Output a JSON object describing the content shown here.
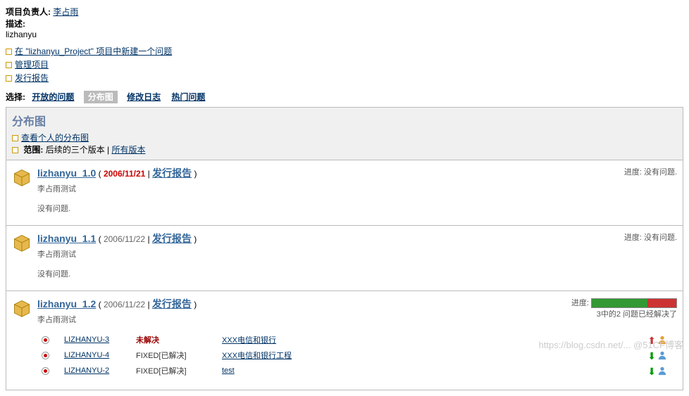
{
  "header": {
    "owner_label": "项目负责人:",
    "owner_name": "李占雨",
    "desc_label": "描述:",
    "desc_value": "lizhanyu"
  },
  "actions": {
    "create_issue": "在 \"lizhanyu_Project\" 项目中新建一个问题",
    "manage_project": "管理项目",
    "release_report": "发行报告"
  },
  "tabs": {
    "select_label": "选择:",
    "open_issues": "开放的问题",
    "chart": "分布图",
    "changelog": "修改日志",
    "hot_issues": "热门问题"
  },
  "panel": {
    "title": "分布图",
    "personal_chart": "查看个人的分布图",
    "scope_label": "范围:",
    "scope_recent": "后续的三个版本 |",
    "scope_all": "所有版本"
  },
  "versions": [
    {
      "name": "lizhanyu_1.0",
      "date": "2006/11/21",
      "overdue": true,
      "report": "发行报告",
      "desc": "李占雨测试",
      "no_issues": "没有问题.",
      "progress_label": "进度:",
      "progress_text": "没有问题."
    },
    {
      "name": "lizhanyu_1.1",
      "date": "2006/11/22",
      "overdue": false,
      "report": "发行报告",
      "desc": "李占雨测试",
      "no_issues": "没有问题.",
      "progress_label": "进度:",
      "progress_text": "没有问题."
    },
    {
      "name": "lizhanyu_1.2",
      "date": "2006/11/22",
      "overdue": false,
      "report": "发行报告",
      "desc": "李占雨测试",
      "progress_label": "进度:",
      "progress_text": "3中的2 问题已经解决了",
      "progress_green": 66,
      "progress_red": 34,
      "issues": [
        {
          "key": "LIZHANYU-3",
          "status": "未解决",
          "resolved": false,
          "summary": "XXX电信和银行",
          "arrow": "up"
        },
        {
          "key": "LIZHANYU-4",
          "status": "FIXED[已解决]",
          "resolved": true,
          "summary": "XXX电信和银行工程",
          "arrow": "down"
        },
        {
          "key": "LIZHANYU-2",
          "status": "FIXED[已解决]",
          "resolved": true,
          "summary": "test",
          "arrow": "down"
        }
      ]
    }
  ],
  "watermark": "https://blog.csdn.net/... @51CF博客"
}
